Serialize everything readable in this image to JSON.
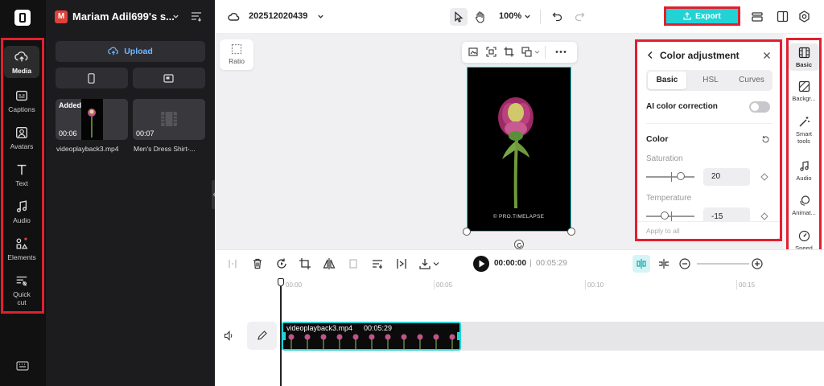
{
  "nav": {
    "items": [
      {
        "label": "Media",
        "icon": "cloud-upload-icon"
      },
      {
        "label": "Captions",
        "icon": "captions-icon"
      },
      {
        "label": "Avatars",
        "icon": "avatar-icon"
      },
      {
        "label": "Text",
        "icon": "text-icon"
      },
      {
        "label": "Audio",
        "icon": "music-icon"
      },
      {
        "label": "Elements",
        "icon": "elements-icon"
      },
      {
        "label": "Quick",
        "label2": "cut",
        "icon": "quick-cut-icon"
      }
    ]
  },
  "media": {
    "project_title": "Mariam Adil699's s...",
    "avatar_letter": "M",
    "upload_label": "Upload",
    "items": [
      {
        "name": "videoplayback3.mp4",
        "duration": "00:06",
        "badge": "Added"
      },
      {
        "name": "Men's Dress Shirt-...",
        "duration": "00:07"
      }
    ]
  },
  "topbar": {
    "project_name": "202512020439",
    "zoom": "100%",
    "export_label": "Export"
  },
  "canvas": {
    "ratio_label": "Ratio",
    "watermark": "© PRO.TIMELAPSE"
  },
  "color_panel": {
    "title": "Color adjustment",
    "tabs": [
      "Basic",
      "HSL",
      "Curves"
    ],
    "ai_label": "AI color correction",
    "section": "Color",
    "saturation_label": "Saturation",
    "saturation_value": "20",
    "temperature_label": "Temperature",
    "temperature_value": "-15",
    "apply_label": "Apply to all"
  },
  "rail": {
    "items": [
      {
        "label": "Basic"
      },
      {
        "label": "Backgr..."
      },
      {
        "label": "Smart",
        "label2": "tools"
      },
      {
        "label": "Audio"
      },
      {
        "label": "Animat..."
      },
      {
        "label": "Speed"
      }
    ]
  },
  "timeline": {
    "current": "00:00:00",
    "separator": "|",
    "total": "00:05:29",
    "ticks": [
      "00:00",
      "00:05",
      "00:10",
      "00:15"
    ],
    "clip_name": "videoplayback3.mp4",
    "clip_duration": "00:05:29"
  },
  "colors": {
    "accent": "#22d3d6",
    "highlight": "#e02030"
  }
}
